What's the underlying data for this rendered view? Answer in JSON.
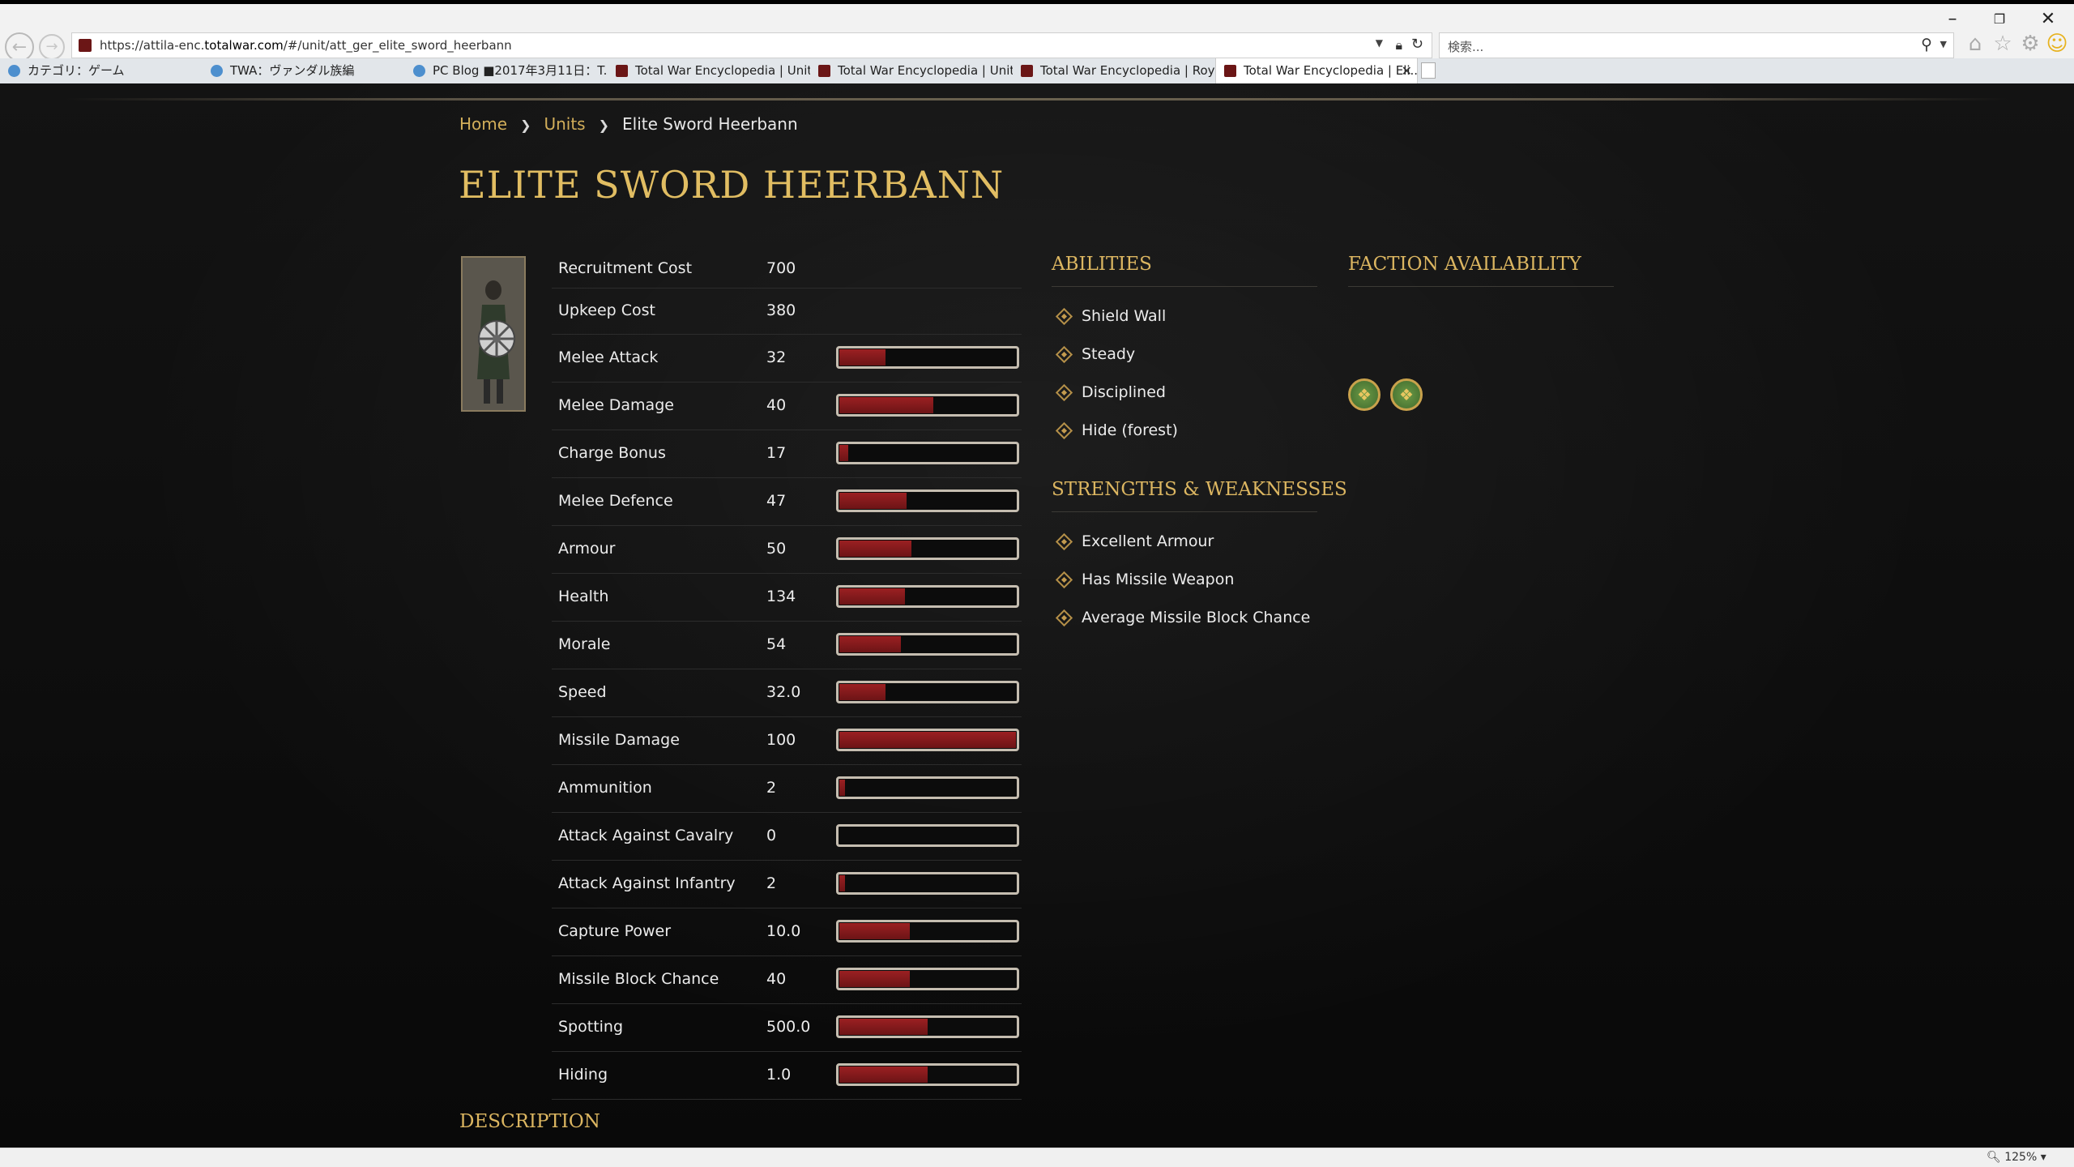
{
  "browser": {
    "url_prefix": "https://attila-enc.",
    "url_domain": "totalwar.com",
    "url_path": "/#/unit/att_ger_elite_sword_heerbann",
    "search_placeholder": "検索...",
    "zoom": "125%",
    "tabs": [
      {
        "label": "カテゴリ：ゲーム",
        "active": false
      },
      {
        "label": "TWA：ヴァンダル族編",
        "active": false
      },
      {
        "label": "PC Blog ■2017年3月11日：T...",
        "active": false
      },
      {
        "label": "Total War Encyclopedia | Units",
        "active": false
      },
      {
        "label": "Total War Encyclopedia | Units",
        "active": false
      },
      {
        "label": "Total War Encyclopedia | Royal...",
        "active": false
      },
      {
        "label": "Total War Encyclopedia | Eli...",
        "active": true
      }
    ]
  },
  "breadcrumb": {
    "items": [
      "Home",
      "Units"
    ],
    "current": "Elite Sword Heerbann"
  },
  "page_title": "ELITE SWORD HEERBANN",
  "stats": [
    {
      "label": "Recruitment Cost",
      "value": "700"
    },
    {
      "label": "Upkeep Cost",
      "value": "380"
    },
    {
      "label": "Melee Attack",
      "value": "32",
      "bar": 0.26
    },
    {
      "label": "Melee Damage",
      "value": "40",
      "bar": 0.53
    },
    {
      "label": "Charge Bonus",
      "value": "17",
      "bar": 0.05
    },
    {
      "label": "Melee Defence",
      "value": "47",
      "bar": 0.38
    },
    {
      "label": "Armour",
      "value": "50",
      "bar": 0.41
    },
    {
      "label": "Health",
      "value": "134",
      "bar": 0.37
    },
    {
      "label": "Morale",
      "value": "54",
      "bar": 0.35
    },
    {
      "label": "Speed",
      "value": "32.0",
      "bar": 0.26
    },
    {
      "label": "Missile Damage",
      "value": "100",
      "bar": 1.0
    },
    {
      "label": "Ammunition",
      "value": "2",
      "bar": 0.03
    },
    {
      "label": "Attack Against Cavalry",
      "value": "0",
      "bar": 0
    },
    {
      "label": "Attack Against Infantry",
      "value": "2",
      "bar": 0.03
    },
    {
      "label": "Capture Power",
      "value": "10.0",
      "bar": 0.4
    },
    {
      "label": "Missile Block Chance",
      "value": "40",
      "bar": 0.4
    },
    {
      "label": "Spotting",
      "value": "500.0",
      "bar": 0.5
    },
    {
      "label": "Hiding",
      "value": "1.0",
      "bar": 0.5
    }
  ],
  "abilities": {
    "heading": "ABILITIES",
    "items": [
      "Shield Wall",
      "Steady",
      "Disciplined",
      "Hide (forest)"
    ]
  },
  "strengths": {
    "heading": "STRENGTHS & WEAKNESSES",
    "items": [
      "Excellent Armour",
      "Has Missile Weapon",
      "Average Missile Block Chance"
    ]
  },
  "faction_availability": {
    "heading": "FACTION AVAILABILITY",
    "icons": [
      "faction-emblem-icon",
      "faction-emblem-icon"
    ]
  },
  "description_heading": "DESCRIPTION",
  "colors": {
    "accent_gold": "#d8b45e",
    "bar_fill": "#9b2022",
    "bar_border": "#c5bdb0"
  }
}
